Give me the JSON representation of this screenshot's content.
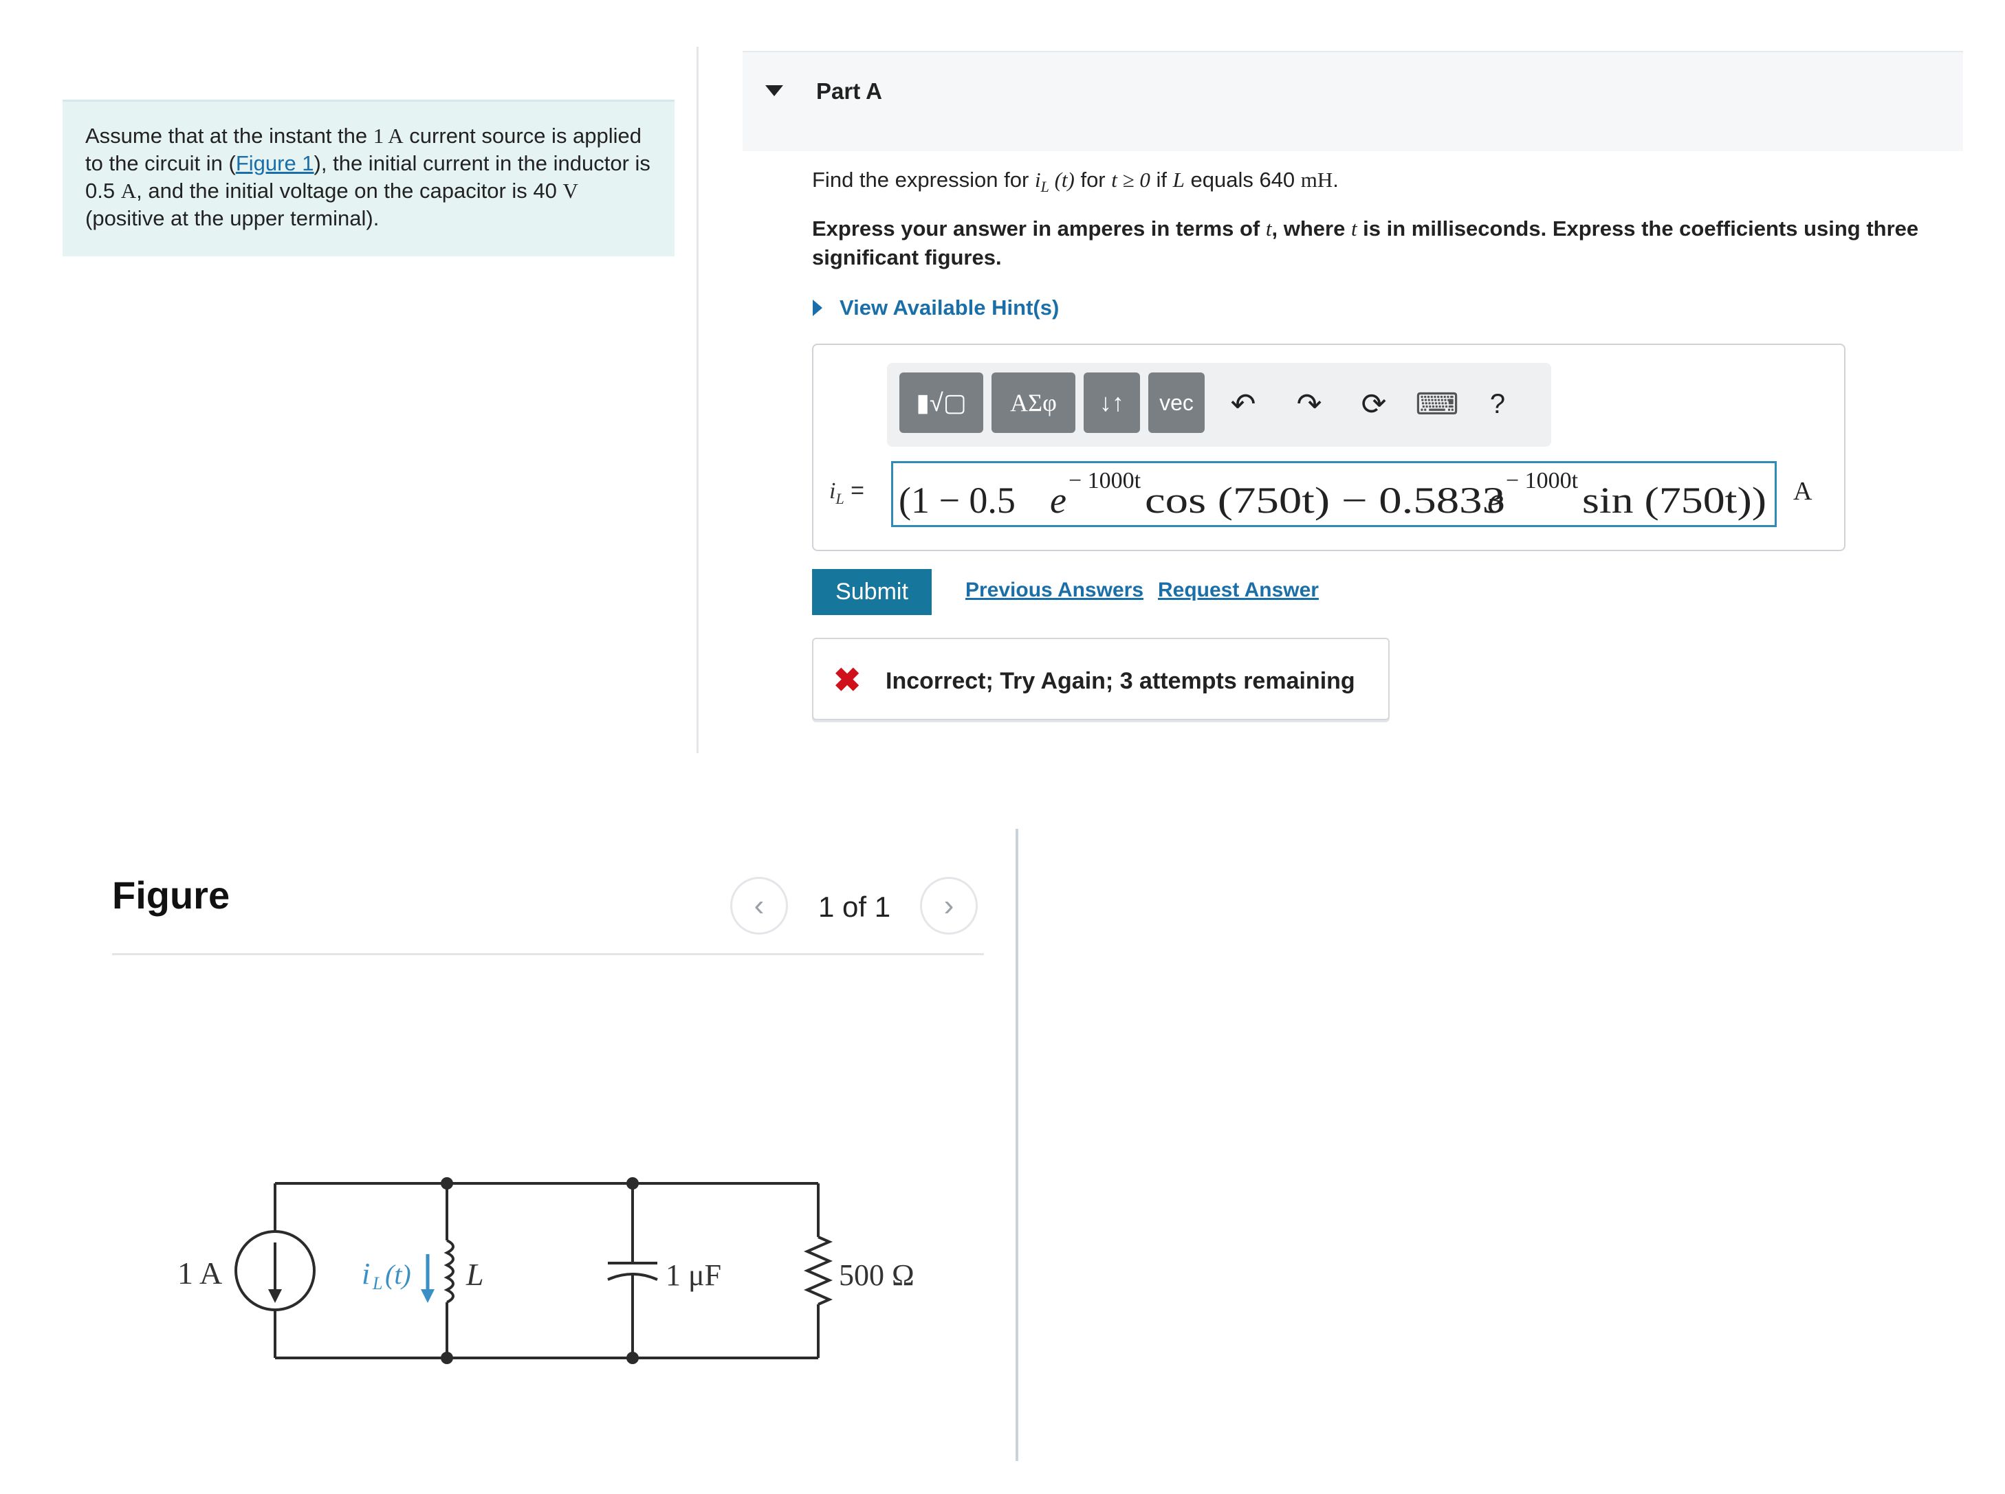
{
  "problem": {
    "p1": "Assume that at the instant the ",
    "m_one_a": "1 A",
    "p2": " current source is applied to the circuit in (",
    "figure_link": "Figure 1",
    "p3": "), the initial current in the inductor is 0.5 ",
    "m_a": "A",
    "p4": ", and the initial voltage on the capacitor is 40 ",
    "m_v": "V",
    "p5": " (positive at the upper terminal)."
  },
  "part": {
    "title": "Part A",
    "q1": "Find the expression for ",
    "q_var": "i",
    "q_sub": "L",
    "q_arg": " (t)",
    "q2": " for ",
    "q_cond": "t ≥ 0",
    "q3": " if ",
    "q_L": "L",
    "q4": " equals 640 ",
    "q_unit": "mH",
    "q5": ".",
    "instr1": "Express your answer in amperes in terms of ",
    "instr_t1": "t",
    "instr2": ", where ",
    "instr_t2": "t",
    "instr3": " is in milliseconds. Express the coefficients using three significant figures.",
    "hint_label": "View Available Hint(s)"
  },
  "toolbar": {
    "templates": "▮√▢",
    "greek": "ΑΣφ",
    "arrows": "↓↑",
    "vec": "vec",
    "undo": "↶",
    "redo": "↷",
    "reset": "⟳",
    "keyboard": "⌨",
    "help": "?"
  },
  "answer": {
    "label_var": "i",
    "label_sub": "L",
    "label_eq": " =",
    "a1": "(1 − 0.5",
    "e1": "e",
    "sup1": "− 1000t",
    "a2": " cos (750t) − 0.5833",
    "e2": "e",
    "sup2": "− 1000t",
    "a3": " sin (750t))",
    "unit": "A"
  },
  "actions": {
    "submit": "Submit",
    "previous": "Previous Answers",
    "request": "Request Answer"
  },
  "feedback": {
    "icon": "✖",
    "text": "Incorrect; Try Again; 3 attempts remaining"
  },
  "figure": {
    "title": "Figure",
    "counter": "1 of 1",
    "prev": "‹",
    "next": "›"
  },
  "circuit": {
    "source": "1 A",
    "il_i": "i",
    "il_sub": "L",
    "il_t": "(t)",
    "inductor": "L",
    "capacitor": "1 μF",
    "resistor": "500 Ω"
  },
  "colors": {
    "accent": "#17769c",
    "link": "#1a6fa8",
    "error": "#d0111b",
    "problem_bg": "#e5f3f3"
  }
}
